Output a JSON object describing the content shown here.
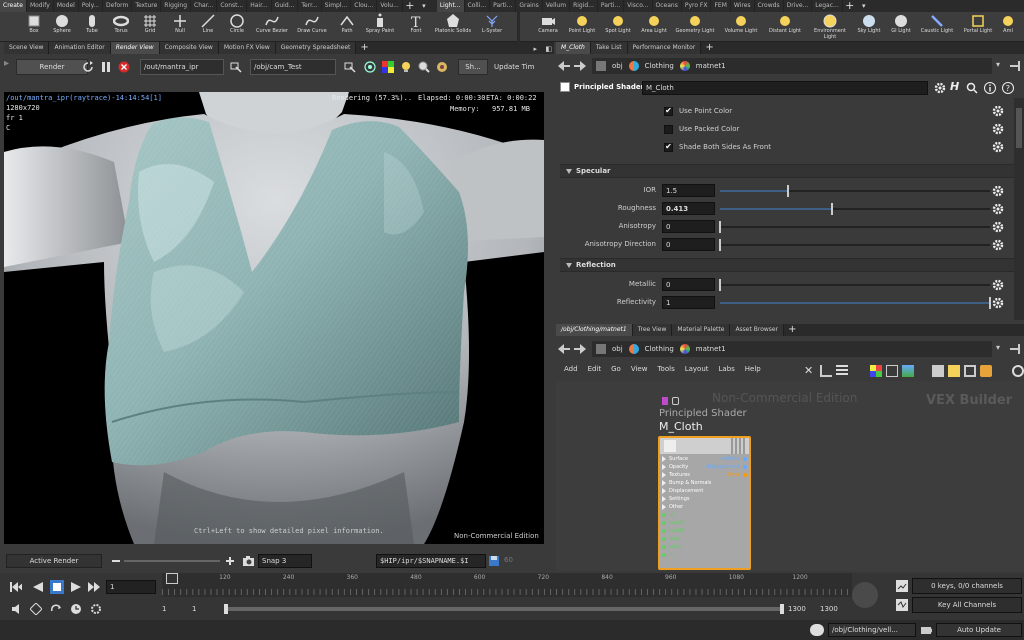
{
  "shelf": {
    "tabs_left": [
      "Create",
      "Modify",
      "Model",
      "Poly...",
      "Deform",
      "Texture",
      "Rigging",
      "Char...",
      "Const...",
      "Hair...",
      "Guid...",
      "Terr...",
      "Simpl...",
      "Clou...",
      "Volu..."
    ],
    "tabs_right": [
      "Light...",
      "Colli...",
      "Parti...",
      "Grains",
      "Vellum",
      "Rigid...",
      "Parti...",
      "Visco...",
      "Oceans",
      "Pyro FX",
      "FEM",
      "Wires",
      "Crowds",
      "Drive...",
      "Legac..."
    ],
    "tools_left": [
      {
        "label": "Box",
        "icon": "box-icon"
      },
      {
        "label": "Sphere",
        "icon": "sphere-icon"
      },
      {
        "label": "Tube",
        "icon": "tube-icon"
      },
      {
        "label": "Torus",
        "icon": "torus-icon"
      },
      {
        "label": "Grid",
        "icon": "grid-icon"
      },
      {
        "label": "Null",
        "icon": "null-icon"
      },
      {
        "label": "Line",
        "icon": "line-icon"
      },
      {
        "label": "Circle",
        "icon": "circle-icon"
      },
      {
        "label": "Curve Bezier",
        "icon": "curve-bezier-icon"
      },
      {
        "label": "Draw Curve",
        "icon": "draw-curve-icon"
      },
      {
        "label": "Path",
        "icon": "path-icon"
      },
      {
        "label": "Spray Paint",
        "icon": "spray-paint-icon"
      },
      {
        "label": "Font",
        "icon": "font-icon"
      },
      {
        "label": "Platonic Solids",
        "icon": "platonic-solids-icon"
      },
      {
        "label": "L-Syster",
        "icon": "l-system-icon"
      }
    ],
    "tools_right": [
      {
        "label": "Camera",
        "icon": "camera-icon"
      },
      {
        "label": "Point Light",
        "icon": "point-light-icon"
      },
      {
        "label": "Spot Light",
        "icon": "spot-light-icon"
      },
      {
        "label": "Area Light",
        "icon": "area-light-icon"
      },
      {
        "label": "Geometry Light",
        "icon": "geometry-light-icon"
      },
      {
        "label": "Volume Light",
        "icon": "volume-light-icon"
      },
      {
        "label": "Distant Light",
        "icon": "distant-light-icon"
      },
      {
        "label": "Environment Light",
        "icon": "environment-light-icon"
      },
      {
        "label": "Sky Light",
        "icon": "sky-light-icon"
      },
      {
        "label": "GI Light",
        "icon": "gi-light-icon"
      },
      {
        "label": "Caustic Light",
        "icon": "caustic-light-icon"
      },
      {
        "label": "Portal Light",
        "icon": "portal-light-icon"
      },
      {
        "label": "Aml",
        "icon": "ambient-light-icon"
      }
    ]
  },
  "left_pane": {
    "tabs": [
      "Scene View",
      "Animation Editor",
      "Render View",
      "Composite View",
      "Motion FX View",
      "Geometry Spreadsheet"
    ],
    "active_tab": 2,
    "toolbar": {
      "render_button": "Render",
      "rop_path": "/out/mantra_ipr",
      "camera_path": "/obj/cam_Test",
      "show_label": "Sh...",
      "update_label": "Update Tim"
    },
    "overlay": {
      "title": "/out/mantra_ipr(raytrace)-14:14:54[1]",
      "resolution": "1280x720",
      "frame": "fr 1",
      "channel": "C",
      "rendering": "Rendering (57.3%)..",
      "elapsed": "Elapsed: 0:00:30",
      "eta": "ETA: 0:00:22",
      "memory_label": "Memory:",
      "memory_value": "957.81 MB",
      "hint": "Ctrl+Left to show detailed pixel information.",
      "watermark": "Non-Commercial Edition"
    },
    "bottom_bar": {
      "active_render": "Active Render",
      "snap_label": "Snap 3",
      "snap_path": "$HIP/ipr/$SNAPNAME.$I",
      "snap_num": "60"
    }
  },
  "param_pane": {
    "tabs": [
      "M_Cloth",
      "Take List",
      "Performance Monitor"
    ],
    "path": {
      "obj": "obj",
      "clothing": "Clothing",
      "matnet": "matnet1"
    },
    "node_type": "Principled Shader",
    "node_name": "M_Cloth",
    "checkboxes": [
      {
        "label": "Use Point Color",
        "checked": "✔"
      },
      {
        "label": "Use Packed Color",
        "checked": ""
      },
      {
        "label": "Shade Both Sides As Front",
        "checked": "✔"
      }
    ],
    "section_specular": "Specular",
    "params_specular": [
      {
        "label": "IOR",
        "value": "1.5",
        "fraction": 0.25
      },
      {
        "label": "Roughness",
        "value": "0.413",
        "fraction": 0.413
      },
      {
        "label": "Anisotropy",
        "value": "0",
        "fraction": 0
      },
      {
        "label": "Anisotropy Direction",
        "value": "0",
        "fraction": 0
      }
    ],
    "section_reflection": "Reflection",
    "params_reflection": [
      {
        "label": "Metallic",
        "value": "0",
        "fraction": 0
      },
      {
        "label": "Reflectivity",
        "value": "1",
        "fraction": 1
      }
    ]
  },
  "network_pane": {
    "tabs": [
      "/obj/Clothing/matnet1",
      "Tree View",
      "Material Palette",
      "Asset Browser"
    ],
    "path": {
      "obj": "obj",
      "clothing": "Clothing",
      "matnet": "matnet1"
    },
    "menu": [
      "Add",
      "Edit",
      "Go",
      "View",
      "Tools",
      "Layout",
      "Labs",
      "Help"
    ],
    "watermark": "Non-Commercial Edition",
    "context_label": "VEX Builder",
    "node": {
      "type": "Principled Shader",
      "name": "M_Cloth",
      "inputs": [
        "Surface",
        "Opacity",
        "Textures",
        "Bump & Normals",
        "Displacement",
        "Settings",
        "Other",
        "uv",
        "baseN",
        "coatN",
        "disp",
        "vdisp",
        "rt"
      ],
      "outputs": [
        "surface",
        "displacement",
        "layer"
      ]
    }
  },
  "timeline": {
    "ticks": [
      "1",
      "120",
      "240",
      "360",
      "480",
      "600",
      "720",
      "840",
      "960",
      "1080",
      "1200"
    ],
    "current_frame": "1",
    "range_start": "1",
    "range_start2": "1",
    "range_end": "1300",
    "range_end2": "1300",
    "keys_info": "0 keys, 0/0 channels",
    "key_all": "Key All Channels",
    "status_path": "/obj/Clothing/vell...",
    "auto_update": "Auto Update"
  },
  "colors": {
    "accent": "#f0a020",
    "node_body": "#d8d8d8",
    "cloth": "#8fb3b3"
  }
}
